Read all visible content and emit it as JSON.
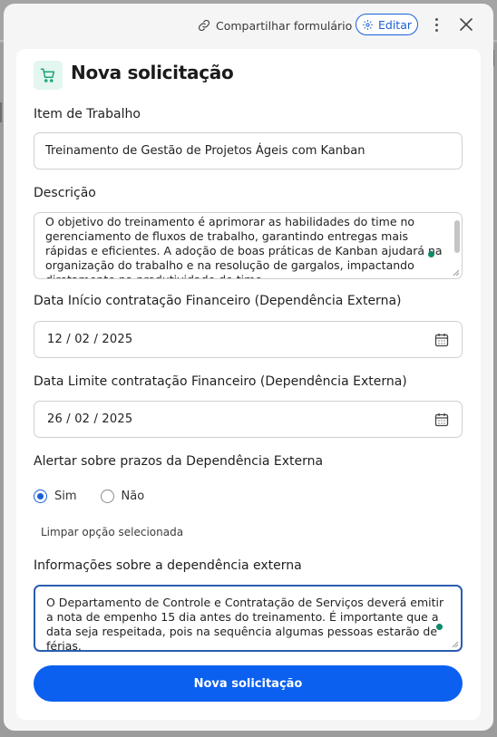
{
  "header": {
    "share_label": "Compartilhar formulário",
    "edit_label": "Editar"
  },
  "title": "Nova solicitação",
  "fields": {
    "item_label": "Item de Trabalho",
    "item_value": "Treinamento de Gestão de Projetos Ágeis com Kanban",
    "desc_label": "Descrição",
    "desc_value": "O objetivo do treinamento é aprimorar as habilidades do time no gerenciamento de fluxos de trabalho, garantindo entregas mais rápidas e eficientes. A adoção de boas práticas de Kanban ajudará na organização do trabalho e na resolução de gargalos, impactando diretamente na produtividade do time.",
    "start_label": "Data Início contratação Financeiro (Dependência Externa)",
    "start_day": "12",
    "start_month": "02",
    "start_year": "2025",
    "end_label": "Data Limite contratação Financeiro (Dependência Externa)",
    "end_day": "26",
    "end_month": "02",
    "end_year": "2025",
    "alert_label": "Alertar sobre prazos da Dependência Externa",
    "alert_yes": "Sim",
    "alert_no": "Não",
    "alert_selected": "Sim",
    "clear_label": "Limpar opção selecionada",
    "info_label": "Informações sobre a dependência externa",
    "info_value": "O Departamento de Controle e Contratação de Serviços deverá emitir a nota de empenho 15 dia antes do treinamento. É importante que a data seja respeitada, pois na sequência algumas pessoas estarão de férias."
  },
  "submit_label": "Nova solicitação",
  "colors": {
    "accent": "#0b60f0",
    "edit_border": "#1a5fd6",
    "title_icon_bg": "#e3f6ef",
    "title_icon": "#1aa37a",
    "grammar_dot": "#0e8a6a"
  },
  "icons": [
    "link-icon",
    "gear-icon",
    "kebab-icon",
    "close-icon",
    "cart-icon",
    "calendar-icon"
  ]
}
